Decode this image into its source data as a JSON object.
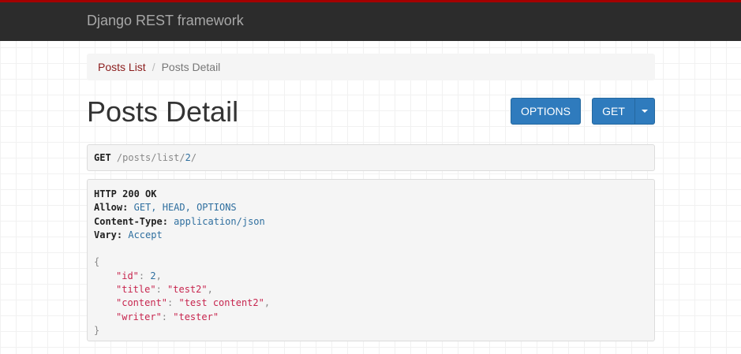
{
  "navbar": {
    "brand": "Django REST framework"
  },
  "breadcrumb": {
    "items": [
      {
        "label": "Posts List",
        "link": true
      },
      {
        "label": "Posts Detail",
        "link": false
      }
    ],
    "separator": "/"
  },
  "page": {
    "title": "Posts Detail"
  },
  "buttons": {
    "options_label": "OPTIONS",
    "get_label": "GET"
  },
  "request": {
    "method": "GET",
    "path_prefix": "/posts/list/",
    "path_id": "2",
    "path_suffix": "/"
  },
  "response": {
    "status": "HTTP 200 OK",
    "headers": [
      {
        "name": "Allow:",
        "value": "GET, HEAD, OPTIONS"
      },
      {
        "name": "Content-Type:",
        "value": "application/json"
      },
      {
        "name": "Vary:",
        "value": "Accept"
      }
    ],
    "body": {
      "open": "{",
      "close": "}",
      "fields": [
        {
          "key": "\"id\"",
          "value": "2",
          "type": "number",
          "trail": ","
        },
        {
          "key": "\"title\"",
          "value": "\"test2\"",
          "type": "string",
          "trail": ","
        },
        {
          "key": "\"content\"",
          "value": "\"test content2\"",
          "type": "string",
          "trail": ","
        },
        {
          "key": "\"writer\"",
          "value": "\"tester\"",
          "type": "string",
          "trail": ""
        }
      ]
    }
  },
  "colors": {
    "navbar_bg": "#2c2c2c",
    "navbar_accent": "#a30000",
    "button_bg": "#2f7bbd",
    "link": "#8b1d1d",
    "string": "#c7254e",
    "literal": "#2f6f9f"
  }
}
